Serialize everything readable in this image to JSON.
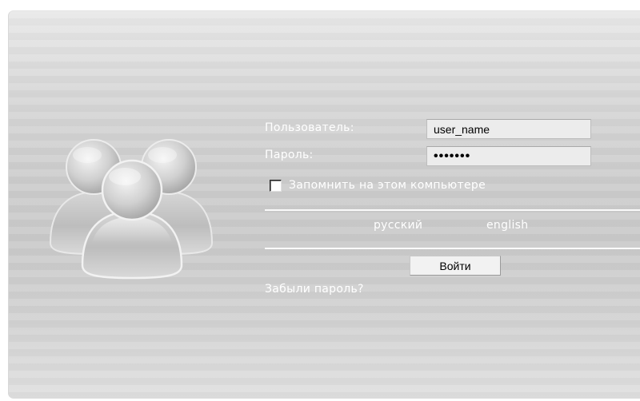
{
  "login": {
    "username_label": "Пользователь:",
    "username_value": "user_name",
    "password_label": "Пароль:",
    "password_value": "•••••••",
    "remember_label": "Запомнить на этом компьютере",
    "remember_checked": false,
    "languages": [
      "русский",
      "english"
    ],
    "submit_label": "Войти",
    "forgot_label": "Забыли пароль?"
  },
  "icons": {
    "users": "users-group-icon"
  },
  "colors": {
    "panel_background": "#cfcfcf",
    "label_text": "#ffffff",
    "input_background": "#ececec"
  }
}
